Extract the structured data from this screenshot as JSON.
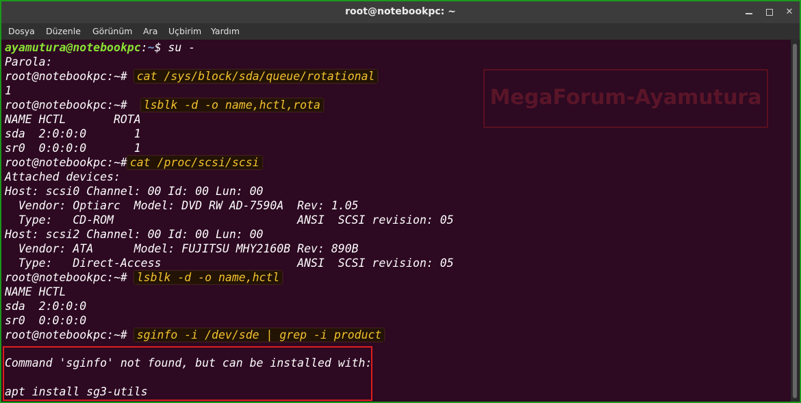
{
  "window": {
    "title": "root@notebookpc: ~"
  },
  "menu": [
    "Dosya",
    "Düzenle",
    "Görünüm",
    "Ara",
    "Uçbirim",
    "Yardım"
  ],
  "watermark": "MegaForum-Ayamutura",
  "terminal": {
    "prompt_user": "ayamutura@notebookpc",
    "prompt_path": "~",
    "prompt_suffix": "$ su -",
    "lines": [
      "Parola:",
      "root@notebookpc:~#",
      "cat /sys/block/sda/queue/rotational",
      "1",
      "root@notebookpc:~#",
      "lsblk -d -o name,hctl,rota",
      "NAME HCTL       ROTA",
      "sda  2:0:0:0       1",
      "sr0  0:0:0:0       1",
      "root@notebookpc:~#",
      "cat /proc/scsi/scsi",
      "Attached devices:",
      "Host: scsi0 Channel: 00 Id: 00 Lun: 00",
      "  Vendor: Optiarc  Model: DVD RW AD-7590A  Rev: 1.05",
      "  Type:   CD-ROM                           ANSI  SCSI revision: 05",
      "Host: scsi2 Channel: 00 Id: 00 Lun: 00",
      "  Vendor: ATA      Model: FUJITSU MHY2160B Rev: 890B",
      "  Type:   Direct-Access                    ANSI  SCSI revision: 05",
      "root@notebookpc:~#",
      "lsblk -d -o name,hctl",
      "NAME HCTL",
      "sda  2:0:0:0",
      "sr0  0:0:0:0",
      "root@notebookpc:~#",
      "sginfo -i /dev/sde | grep -i product",
      "Command 'sginfo' not found, but can be installed with:",
      "apt install sg3-utils"
    ]
  }
}
